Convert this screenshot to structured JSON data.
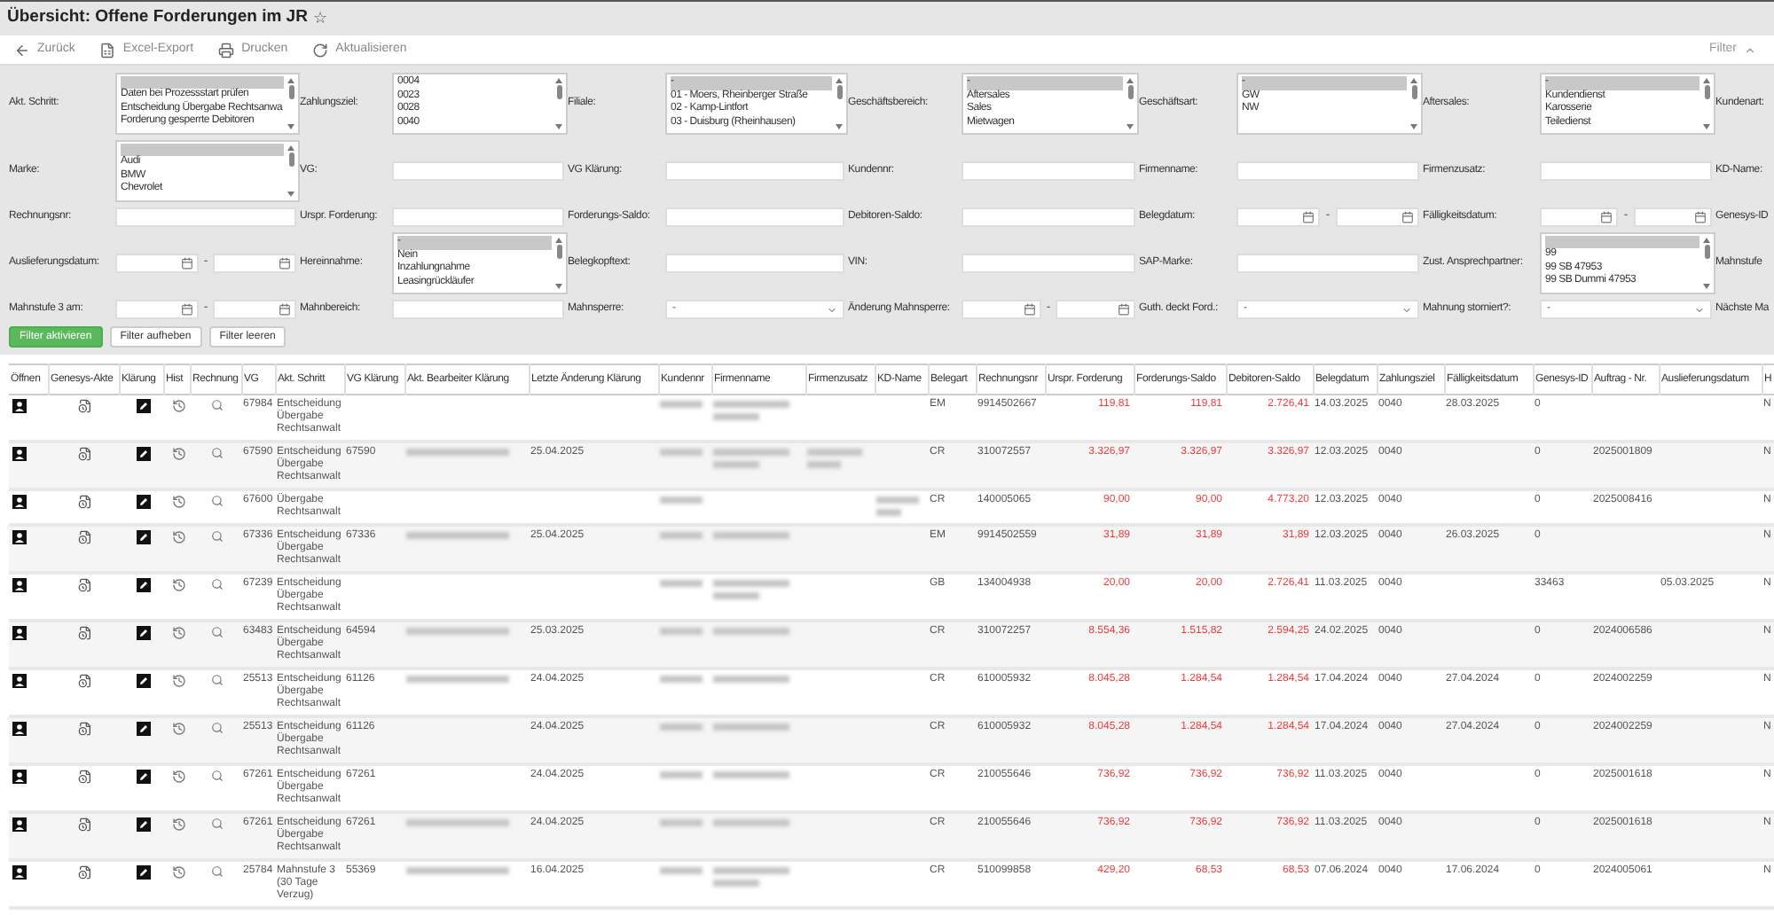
{
  "window": {
    "title": "Übersicht: Offene Forderungen im JR",
    "star": "☆"
  },
  "toolbar": {
    "buttons": [
      {
        "kind": "back",
        "label": "Zurück"
      },
      {
        "kind": "excel",
        "label": "Excel-Export"
      },
      {
        "kind": "print",
        "label": "Drucken"
      },
      {
        "kind": "refresh",
        "label": "Aktualisieren"
      }
    ],
    "filter_toggle": {
      "label": "Filter",
      "expanded": true
    }
  },
  "filter_rows": [
    {
      "items": [
        {
          "label": "Akt. Schritt:",
          "kind": "listbox",
          "blank_selected": true,
          "options": [
            {
              "label": "Daten bei Prozessstart prüfen",
              "selected": false
            },
            {
              "label": "Entscheidung Übergabe Rechtsanwa",
              "selected": false
            },
            {
              "label": "Forderung gesperrte Debitoren",
              "selected": false
            }
          ]
        },
        {
          "label": "Zahlungsziel:",
          "kind": "listbox",
          "options": [
            {
              "label": "0004",
              "selected": false
            },
            {
              "label": "0023",
              "selected": false
            },
            {
              "label": "0028",
              "selected": false
            },
            {
              "label": "0040",
              "selected": false
            }
          ]
        },
        {
          "label": "Filiale:",
          "kind": "listbox",
          "options": [
            {
              "label": "-",
              "selected": true
            },
            {
              "label": "01 - Moers, Rheinberger Straße",
              "selected": false
            },
            {
              "label": "02 - Kamp-Lintfort",
              "selected": false
            },
            {
              "label": "03 - Duisburg (Rheinhausen)",
              "selected": false
            }
          ]
        },
        {
          "label": "Geschäftsbereich:",
          "kind": "listbox",
          "options": [
            {
              "label": "-",
              "selected": true
            },
            {
              "label": "Aftersales",
              "selected": false
            },
            {
              "label": "Sales",
              "selected": false
            },
            {
              "label": "Mietwagen",
              "selected": false
            }
          ]
        },
        {
          "label": "Geschäftsart:",
          "kind": "listbox",
          "options": [
            {
              "label": "-",
              "selected": true
            },
            {
              "label": "GW",
              "selected": false
            },
            {
              "label": "NW",
              "selected": false
            }
          ]
        },
        {
          "label": "Aftersales:",
          "kind": "listbox",
          "options": [
            {
              "label": "-",
              "selected": true
            },
            {
              "label": "Kundendienst",
              "selected": false
            },
            {
              "label": "Karosserie",
              "selected": false
            },
            {
              "label": "Teiledienst",
              "selected": false
            }
          ]
        },
        {
          "label": "Kundenart:",
          "kind": "label"
        }
      ]
    },
    {
      "items": [
        {
          "label": "Marke:",
          "kind": "listbox",
          "blank_selected": true,
          "options": [
            {
              "label": "Audi",
              "selected": false
            },
            {
              "label": "BMW",
              "selected": false
            },
            {
              "label": "Chevrolet",
              "selected": false
            }
          ]
        },
        {
          "label": "VG:",
          "kind": "input"
        },
        {
          "label": "VG Klärung:",
          "kind": "input"
        },
        {
          "label": "Kundennr:",
          "kind": "input"
        },
        {
          "label": "Firmenname:",
          "kind": "input"
        },
        {
          "label": "Firmenzusatz:",
          "kind": "input"
        },
        {
          "label": "KD-Name:",
          "kind": "label"
        }
      ]
    },
    {
      "items": [
        {
          "label": "Rechnungsnr:",
          "kind": "input"
        },
        {
          "label": "Urspr. Forderung:",
          "kind": "input"
        },
        {
          "label": "Forderungs-Saldo:",
          "kind": "input"
        },
        {
          "label": "Debitoren-Saldo:",
          "kind": "input"
        },
        {
          "label": "Belegdatum:",
          "kind": "daterange",
          "separator": "-"
        },
        {
          "label": "Fälligkeitsdatum:",
          "kind": "daterange",
          "separator": "-"
        },
        {
          "label": "Genesys-ID",
          "kind": "label"
        }
      ]
    },
    {
      "items": [
        {
          "label": "Auslieferungsdatum:",
          "kind": "daterange",
          "separator": "-"
        },
        {
          "label": "Hereinnahme:",
          "kind": "listbox",
          "options": [
            {
              "label": "-",
              "selected": true
            },
            {
              "label": "Nein",
              "selected": false
            },
            {
              "label": "Inzahlungnahme",
              "selected": false
            },
            {
              "label": "Leasingrückläufer",
              "selected": false
            }
          ]
        },
        {
          "label": "Belegkopftext:",
          "kind": "input"
        },
        {
          "label": "VIN:",
          "kind": "input"
        },
        {
          "label": "SAP-Marke:",
          "kind": "input"
        },
        {
          "label": "Zust. Ansprechpartner:",
          "kind": "listbox",
          "blank_selected": true,
          "options": [
            {
              "label": "99",
              "selected": false
            },
            {
              "label": "99 SB 47953",
              "selected": false
            },
            {
              "label": "99 SB Dummi 47953",
              "selected": false
            }
          ]
        },
        {
          "label": "Mahnstufe",
          "kind": "label"
        }
      ]
    },
    {
      "items": [
        {
          "label": "Mahnstufe 3 am:",
          "kind": "daterange",
          "separator": "-"
        },
        {
          "label": "Mahnbereich:",
          "kind": "input"
        },
        {
          "label": "Mahnsperre:",
          "kind": "select",
          "value": "-"
        },
        {
          "label": "Änderung Mahnsperre:",
          "kind": "daterange",
          "separator": "-"
        },
        {
          "label": "Guth. deckt Ford.:",
          "kind": "select",
          "value": "-"
        },
        {
          "label": "Mahnung storniert?:",
          "kind": "select",
          "value": "-"
        },
        {
          "label": "Nächste Ma",
          "kind": "label"
        }
      ]
    }
  ],
  "filter_buttons": [
    {
      "label": "Filter aktivieren",
      "primary": true
    },
    {
      "label": "Filter aufheben",
      "primary": false
    },
    {
      "label": "Filter leeren",
      "primary": false
    }
  ],
  "table": {
    "action_columns": [
      {
        "label": "Öffnen",
        "kind": "contact"
      },
      {
        "label": "Genesys-Akte",
        "kind": "file"
      },
      {
        "label": "Klärung",
        "kind": "edit"
      },
      {
        "label": "Hist",
        "kind": "history"
      },
      {
        "label": "Rechnung",
        "kind": "search"
      }
    ],
    "columns": [
      {
        "label": "VG",
        "kind": "text"
      },
      {
        "label": "Akt. Schritt",
        "kind": "text"
      },
      {
        "label": "VG Klärung",
        "kind": "text"
      },
      {
        "label": "Akt. Bearbeiter Klärung",
        "kind": "text"
      },
      {
        "label": "Letzte Änderung Klärung",
        "kind": "text"
      },
      {
        "label": "Kundennr",
        "kind": "text"
      },
      {
        "label": "Firmenname",
        "kind": "text"
      },
      {
        "label": "Firmenzusatz",
        "kind": "text"
      },
      {
        "label": "KD-Name",
        "kind": "text"
      },
      {
        "label": "Belegart",
        "kind": "text"
      },
      {
        "label": "Rechnungsnr",
        "kind": "text"
      },
      {
        "label": "Urspr. Forderung",
        "kind": "amount"
      },
      {
        "label": "Forderungs-Saldo",
        "kind": "amount"
      },
      {
        "label": "Debitoren-Saldo",
        "kind": "amount"
      },
      {
        "label": "Belegdatum",
        "kind": "text"
      },
      {
        "label": "Zahlungsziel",
        "kind": "text"
      },
      {
        "label": "Fälligkeitsdatum",
        "kind": "text"
      },
      {
        "label": "Genesys-ID",
        "kind": "text"
      },
      {
        "label": "Auftrag - Nr.",
        "kind": "text"
      },
      {
        "label": "Auslieferungsdatum",
        "kind": "text"
      },
      {
        "label": "H",
        "kind": "text"
      }
    ],
    "rows": [
      {
        "cells": [
          "67984",
          "Entscheidung Übergabe Rechtsanwalt",
          null,
          null,
          null,
          {
            "kind": "blurred",
            "long": false
          },
          {
            "kind": "blurred",
            "long": true
          },
          null,
          null,
          "EM",
          "9914502667",
          "119,81",
          "119,81",
          "2.726,41",
          "14.03.2025",
          "0040",
          "28.03.2025",
          "0",
          null,
          null,
          "N"
        ]
      },
      {
        "cells": [
          "67590",
          "Entscheidung Übergabe Rechtsanwalt",
          "67590",
          {
            "kind": "blurred",
            "long": false
          },
          "25.04.2025",
          {
            "kind": "blurred",
            "long": false
          },
          {
            "kind": "blurred",
            "long": true
          },
          {
            "kind": "blurred",
            "long": true
          },
          null,
          "CR",
          "310072557",
          "3.326,97",
          "3.326,97",
          "3.326,97",
          "12.03.2025",
          "0040",
          null,
          "0",
          "2025001809",
          null,
          "N"
        ]
      },
      {
        "cells": [
          "67600",
          "Übergabe Rechtsanwalt",
          null,
          null,
          null,
          {
            "kind": "blurred",
            "long": false
          },
          null,
          null,
          {
            "kind": "blurred",
            "long": true
          },
          "CR",
          "140005065",
          "90,00",
          "90,00",
          "4.773,20",
          "12.03.2025",
          "0040",
          null,
          "0",
          "2025008416",
          null,
          "N"
        ]
      },
      {
        "cells": [
          "67336",
          "Entscheidung Übergabe Rechtsanwalt",
          "67336",
          {
            "kind": "blurred",
            "long": false
          },
          "25.04.2025",
          {
            "kind": "blurred",
            "long": false
          },
          {
            "kind": "blurred",
            "long": false
          },
          null,
          null,
          "EM",
          "9914502559",
          "31,89",
          "31,89",
          "31,89",
          "12.03.2025",
          "0040",
          "26.03.2025",
          "0",
          null,
          null,
          "N"
        ]
      },
      {
        "cells": [
          "67239",
          "Entscheidung Übergabe Rechtsanwalt",
          null,
          null,
          null,
          {
            "kind": "blurred",
            "long": false
          },
          {
            "kind": "blurred",
            "long": true
          },
          null,
          null,
          "GB",
          "134004938",
          "20,00",
          "20,00",
          "2.726,41",
          "11.03.2025",
          "0040",
          null,
          "33463",
          null,
          "05.03.2025",
          "N"
        ]
      },
      {
        "cells": [
          "63483",
          "Entscheidung Übergabe Rechtsanwalt",
          "64594",
          {
            "kind": "blurred",
            "long": false
          },
          "25.03.2025",
          {
            "kind": "blurred",
            "long": false
          },
          {
            "kind": "blurred",
            "long": false
          },
          null,
          null,
          "CR",
          "310072257",
          "8.554,36",
          "1.515,82",
          "2.594,25",
          "24.02.2025",
          "0040",
          null,
          "0",
          "2024006586",
          null,
          "N"
        ]
      },
      {
        "cells": [
          "25513",
          "Entscheidung Übergabe Rechtsanwalt",
          "61126",
          {
            "kind": "blurred",
            "long": false
          },
          "24.04.2025",
          {
            "kind": "blurred",
            "long": false
          },
          {
            "kind": "blurred",
            "long": false
          },
          null,
          null,
          "CR",
          "610005932",
          "8.045,28",
          "1.284,54",
          "1.284,54",
          "17.04.2024",
          "0040",
          "27.04.2024",
          "0",
          "2024002259",
          null,
          "N"
        ]
      },
      {
        "cells": [
          "25513",
          "Entscheidung Übergabe Rechtsanwalt",
          "61126",
          null,
          "24.04.2025",
          {
            "kind": "blurred",
            "long": false
          },
          {
            "kind": "blurred",
            "long": false
          },
          null,
          null,
          "CR",
          "610005932",
          "8.045,28",
          "1.284,54",
          "1.284,54",
          "17.04.2024",
          "0040",
          "27.04.2024",
          "0",
          "2024002259",
          null,
          "N"
        ]
      },
      {
        "cells": [
          "67261",
          "Entscheidung Übergabe Rechtsanwalt",
          "67261",
          null,
          "24.04.2025",
          {
            "kind": "blurred",
            "long": false
          },
          {
            "kind": "blurred",
            "long": false
          },
          null,
          null,
          "CR",
          "210055646",
          "736,92",
          "736,92",
          "736,92",
          "11.03.2025",
          "0040",
          null,
          "0",
          "2025001618",
          null,
          "N"
        ]
      },
      {
        "cells": [
          "67261",
          "Entscheidung Übergabe Rechtsanwalt",
          "67261",
          {
            "kind": "blurred",
            "long": false
          },
          "24.04.2025",
          {
            "kind": "blurred",
            "long": false
          },
          {
            "kind": "blurred",
            "long": false
          },
          null,
          null,
          "CR",
          "210055646",
          "736,92",
          "736,92",
          "736,92",
          "11.03.2025",
          "0040",
          null,
          "0",
          "2025001618",
          null,
          "N"
        ]
      },
      {
        "cells": [
          "25784",
          "Mahnstufe 3 (30 Tage Verzug)",
          "55369",
          {
            "kind": "blurred",
            "long": false
          },
          "16.04.2025",
          {
            "kind": "blurred",
            "long": false
          },
          {
            "kind": "blurred",
            "long": true
          },
          null,
          null,
          "CR",
          "510099858",
          "429,20",
          "68,53",
          "68,53",
          "07.06.2024",
          "0040",
          "17.06.2024",
          "0",
          "2024005061",
          null,
          "N"
        ]
      }
    ]
  }
}
